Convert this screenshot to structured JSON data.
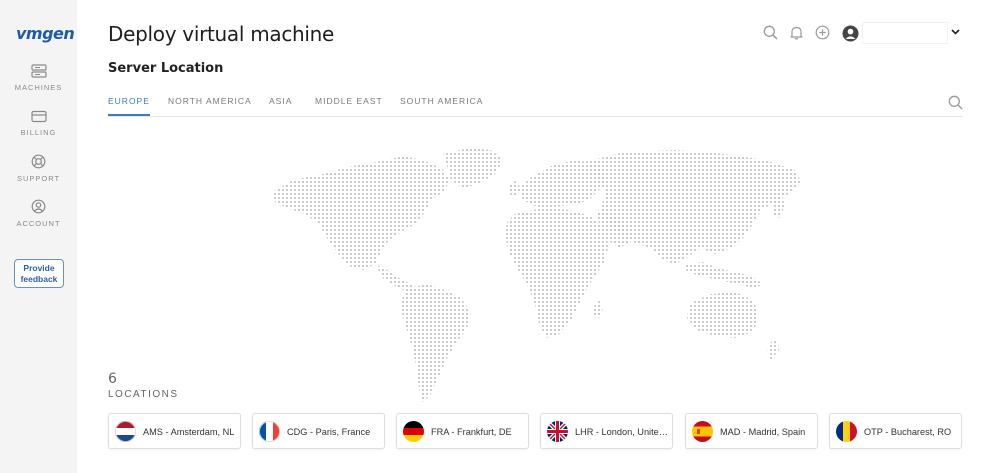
{
  "app": {
    "logo": "vmgen"
  },
  "sidebar": {
    "items": [
      {
        "label": "MACHINES",
        "icon": "server-icon"
      },
      {
        "label": "BILLING",
        "icon": "credit-card-icon"
      },
      {
        "label": "SUPPORT",
        "icon": "lifebuoy-icon"
      },
      {
        "label": "ACCOUNT",
        "icon": "user-circle-icon"
      }
    ],
    "feedback_line1": "Provide",
    "feedback_line2": "feedback"
  },
  "header": {
    "title": "Deploy virtual machine",
    "icons": [
      "search-icon",
      "bell-icon",
      "plus-circle-icon"
    ],
    "user_name": ""
  },
  "section_title": "Server Location",
  "tabs": [
    {
      "label": "EUROPE",
      "active": true
    },
    {
      "label": "NORTH AMERICA",
      "active": false
    },
    {
      "label": "ASIA",
      "active": false
    },
    {
      "label": "MIDDLE EAST",
      "active": false
    },
    {
      "label": "SOUTH AMERICA",
      "active": false
    }
  ],
  "locations": {
    "count": "6",
    "label": "LOCATIONS",
    "items": [
      {
        "label": "AMS - Amsterdam, NL",
        "flag": "nl-flag-icon"
      },
      {
        "label": "CDG - Paris, France",
        "flag": "fr-flag-icon"
      },
      {
        "label": "FRA - Frankfurt, DE",
        "flag": "de-flag-icon"
      },
      {
        "label": "LHR - London, United Kingdom",
        "flag": "gb-flag-icon"
      },
      {
        "label": "MAD - Madrid, Spain",
        "flag": "es-flag-icon"
      },
      {
        "label": "OTP - Bucharest, RO",
        "flag": "ro-flag-icon"
      }
    ]
  },
  "colors": {
    "accent": "#3d7bb8",
    "logo": "#1f5ca8",
    "map_dots": "#bdbdbd"
  }
}
